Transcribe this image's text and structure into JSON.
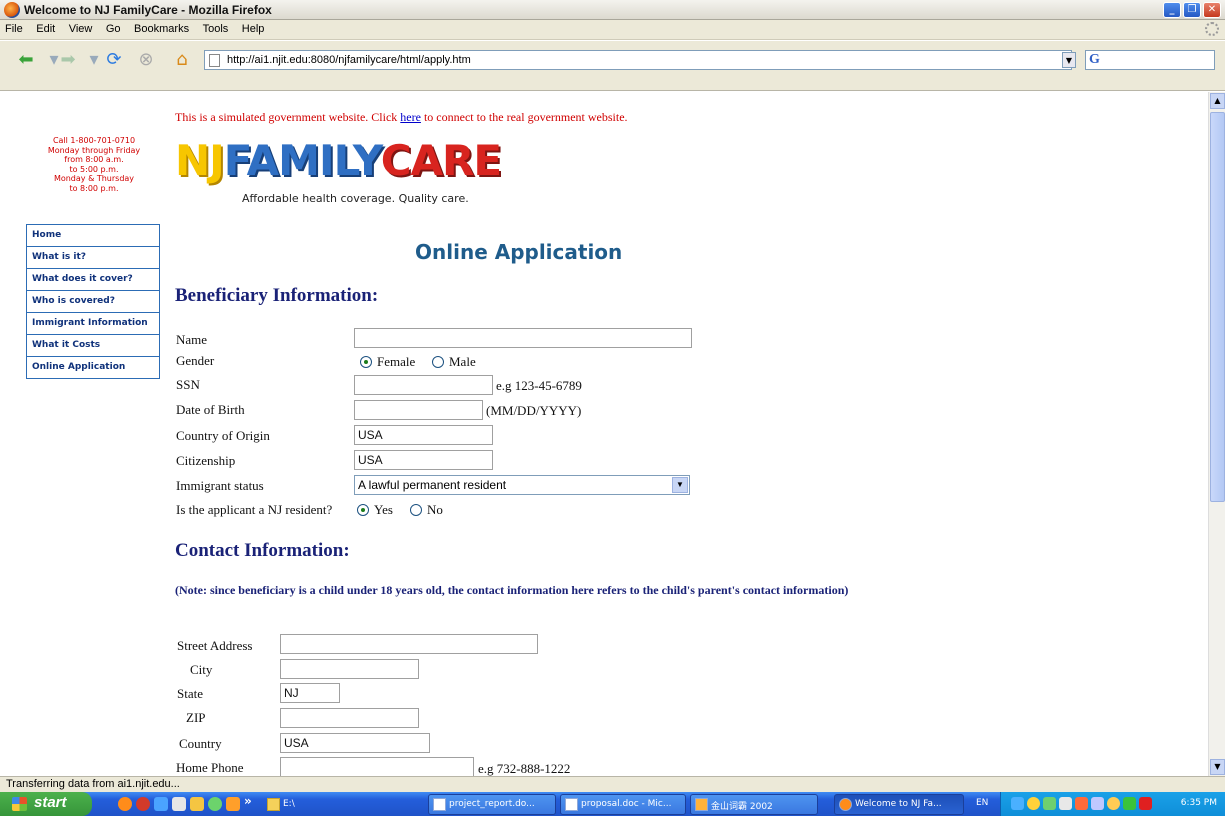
{
  "window": {
    "title": "Welcome to NJ FamilyCare - Mozilla Firefox"
  },
  "menu": [
    "File",
    "Edit",
    "View",
    "Go",
    "Bookmarks",
    "Tools",
    "Help"
  ],
  "address": {
    "url": "http://ai1.njit.edu:8080/njfamilycare/html/apply.htm"
  },
  "notice": {
    "before": "This is a simulated government website. Click ",
    "link": "here",
    "after": " to connect to the real government website."
  },
  "contact_hours": [
    "Call 1-800-701-0710",
    "Monday through Friday",
    "from 8:00 a.m.",
    "to 5:00 p.m.",
    "Monday & Thursday",
    "to 8:00 p.m."
  ],
  "logo": {
    "part1": "NJ",
    "part2": "FAMILY",
    "part3": "CARE",
    "tagline": "Affordable health coverage. Quality care."
  },
  "sidebar": {
    "items": [
      {
        "label": "Home"
      },
      {
        "label": "What is it?"
      },
      {
        "label": "What does it cover?"
      },
      {
        "label": "Who is covered?"
      },
      {
        "label": "Immigrant Information"
      },
      {
        "label": "What it Costs"
      },
      {
        "label": "Online Application"
      }
    ]
  },
  "page_title": "Online Application",
  "beneficiary": {
    "heading": "Beneficiary Information:",
    "name_label": "Name",
    "name_value": "",
    "gender_label": "Gender",
    "gender_female": "Female",
    "gender_male": "Male",
    "gender_selected": "Female",
    "ssn_label": "SSN",
    "ssn_value": "",
    "ssn_hint": "e.g 123-45-6789",
    "dob_label": "Date of Birth",
    "dob_value": "",
    "dob_hint": "(MM/DD/YYYY)",
    "country_label": "Country of Origin",
    "country_value": "USA",
    "citizenship_label": "Citizenship",
    "citizenship_value": "USA",
    "immigrant_label": "Immigrant status",
    "immigrant_value": "A lawful permanent resident",
    "resident_label": "Is the applicant a NJ resident?",
    "resident_yes": "Yes",
    "resident_no": "No",
    "resident_selected": "Yes"
  },
  "contact": {
    "heading": "Contact Information:",
    "note": "(Note: since beneficiary is a child under 18 years old, the contact information here refers to the child's parent's contact information)",
    "street_label": "Street Address",
    "street_value": "",
    "city_label": "City",
    "city_value": "",
    "state_label": "State",
    "state_value": "NJ",
    "zip_label": "ZIP",
    "zip_value": "",
    "country_label": "Country",
    "country_value": "USA",
    "phone_label": "Home Phone",
    "phone_value": "",
    "phone_hint": "e.g 732-888-1222"
  },
  "status_text": "Transferring data from ai1.njit.edu...",
  "taskbar": {
    "start": "start",
    "folder": "E:\\",
    "tasks": [
      {
        "label": "project_report.do..."
      },
      {
        "label": "proposal.doc - Mic..."
      },
      {
        "label": "金山词霸 2002"
      },
      {
        "label": "Welcome to NJ Fa..."
      }
    ],
    "lang": "EN",
    "clock": "6:35 PM"
  },
  "colors": {
    "notice_red": "#d00000",
    "heading_navy": "#1a2277",
    "title_blue": "#1f5c8b",
    "nav_border": "#2c6cb5"
  }
}
